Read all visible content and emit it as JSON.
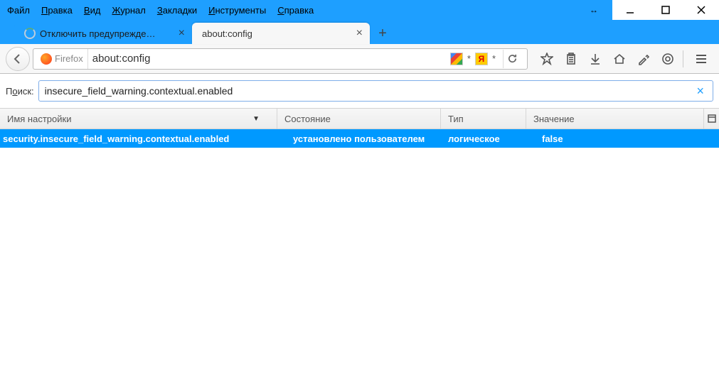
{
  "menubar": {
    "file": {
      "pre": "Ф",
      "u": "",
      "post": "айл"
    },
    "edit": {
      "pre": "",
      "u": "П",
      "post": "равка"
    },
    "view": {
      "pre": "",
      "u": "В",
      "post": "ид"
    },
    "history": {
      "pre": "",
      "u": "Ж",
      "post": "урнал"
    },
    "bookmarks": {
      "pre": "",
      "u": "З",
      "post": "акладки"
    },
    "tools": {
      "pre": "",
      "u": "И",
      "post": "нструменты"
    },
    "help": {
      "pre": "",
      "u": "С",
      "post": "правка"
    }
  },
  "mini_icon_glyph": "↔",
  "tabs": [
    {
      "label": "Отключить предупрежде…",
      "active": false,
      "throbber": true
    },
    {
      "label": "about:config",
      "active": true,
      "throbber": false
    }
  ],
  "identity_label": "Firefox",
  "url": "about:config",
  "url_extras": {
    "star1": "*",
    "star2": "*"
  },
  "search": {
    "label_pre": "П",
    "label_u": "о",
    "label_post": "иск:",
    "value": "insecure_field_warning.contextual.enabled"
  },
  "columns": {
    "name": "Имя настройки",
    "state": "Состояние",
    "type": "Тип",
    "value": "Значение",
    "sort_glyph": "▼"
  },
  "rows": [
    {
      "name": "security.insecure_field_warning.contextual.enabled",
      "state": "установлено пользователем",
      "type": "логическое",
      "value": "false"
    }
  ]
}
